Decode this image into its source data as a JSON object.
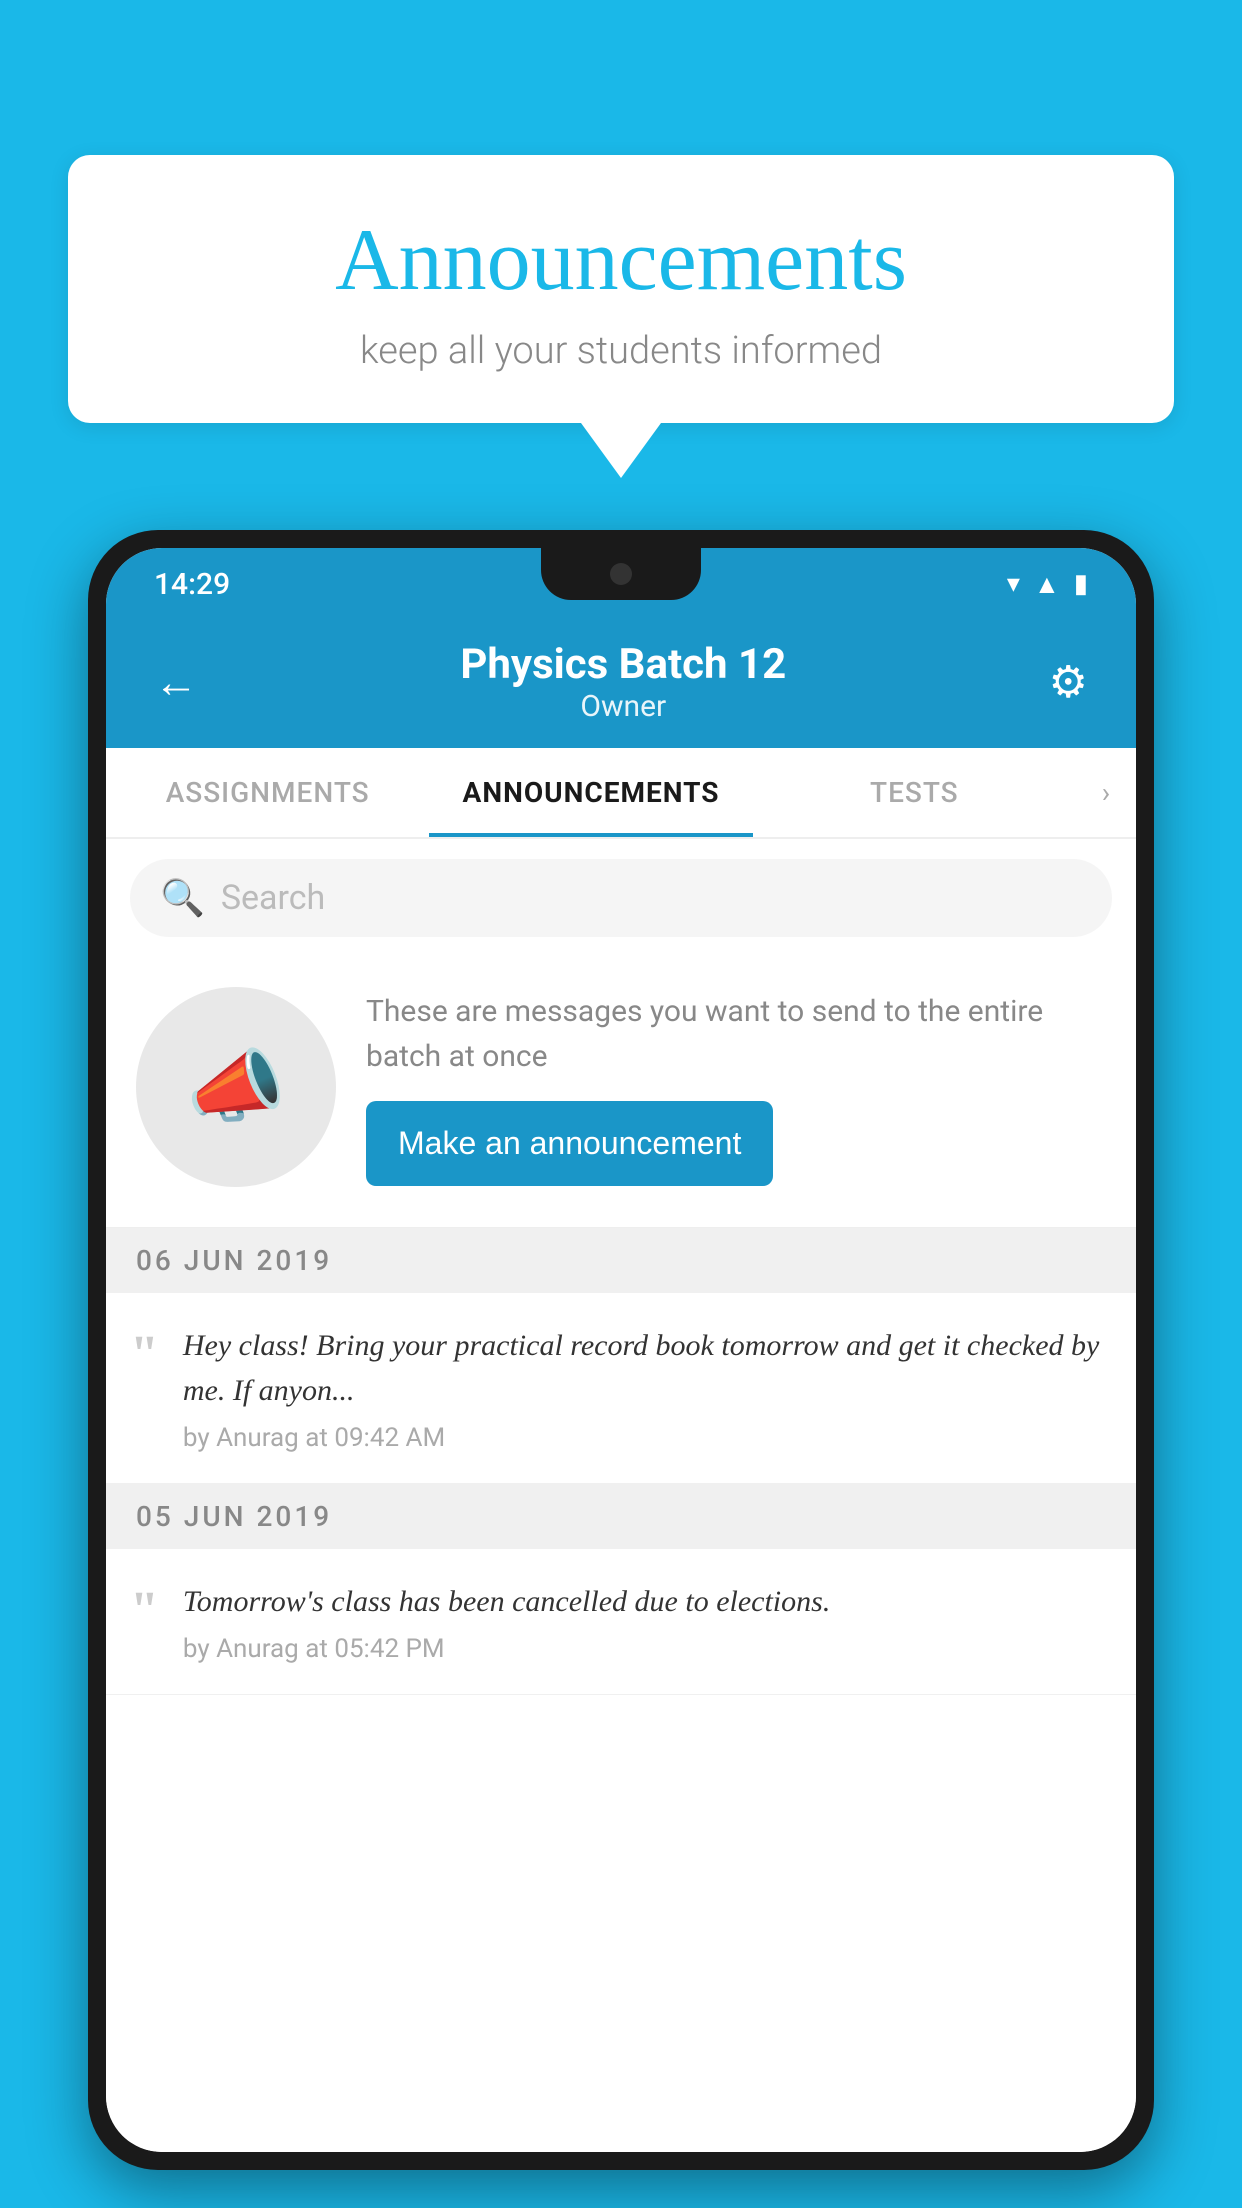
{
  "background_color": "#1ab8e8",
  "speech_bubble": {
    "title": "Announcements",
    "subtitle": "keep all your students informed"
  },
  "status_bar": {
    "time": "14:29",
    "icons": [
      "wifi",
      "signal",
      "battery"
    ]
  },
  "header": {
    "title": "Physics Batch 12",
    "subtitle": "Owner",
    "back_label": "←",
    "gear_label": "⚙"
  },
  "tabs": [
    {
      "label": "ASSIGNMENTS",
      "active": false
    },
    {
      "label": "ANNOUNCEMENTS",
      "active": true
    },
    {
      "label": "TESTS",
      "active": false
    }
  ],
  "search": {
    "placeholder": "Search"
  },
  "promo": {
    "description": "These are messages you want to\nsend to the entire batch at once",
    "button_label": "Make an announcement"
  },
  "announcements": [
    {
      "date": "06  JUN  2019",
      "items": [
        {
          "text": "Hey class! Bring your practical record book tomorrow and get it checked by me. If anyon...",
          "by": "by Anurag at 09:42 AM"
        }
      ]
    },
    {
      "date": "05  JUN  2019",
      "items": [
        {
          "text": "Tomorrow's class has been cancelled due to elections.",
          "by": "by Anurag at 05:42 PM"
        }
      ]
    }
  ]
}
